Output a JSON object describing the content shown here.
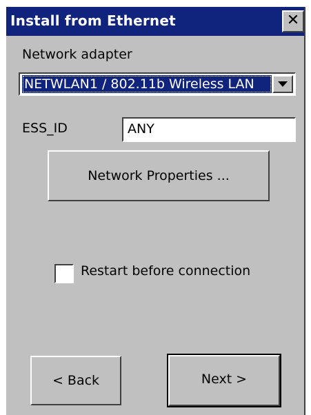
{
  "window": {
    "title": "Install from Ethernet",
    "close_glyph": "✕"
  },
  "network_adapter": {
    "label": "Network adapter",
    "selected_value": "NETWLAN1 / 802.11b Wireless LAN"
  },
  "ess_id": {
    "label": "ESS_ID",
    "value": "ANY"
  },
  "network_properties_button": {
    "label": "Network Properties ..."
  },
  "restart_checkbox": {
    "label": "Restart before connection",
    "checked": false
  },
  "navigation": {
    "back_label": "< Back",
    "next_label": "Next >"
  },
  "colors": {
    "titlebar": "#10247d",
    "dialog_background": "#c0c0c0",
    "selection": "#10247d"
  },
  "icons": {
    "close": "close-icon",
    "dropdown": "chevron-down-icon"
  }
}
